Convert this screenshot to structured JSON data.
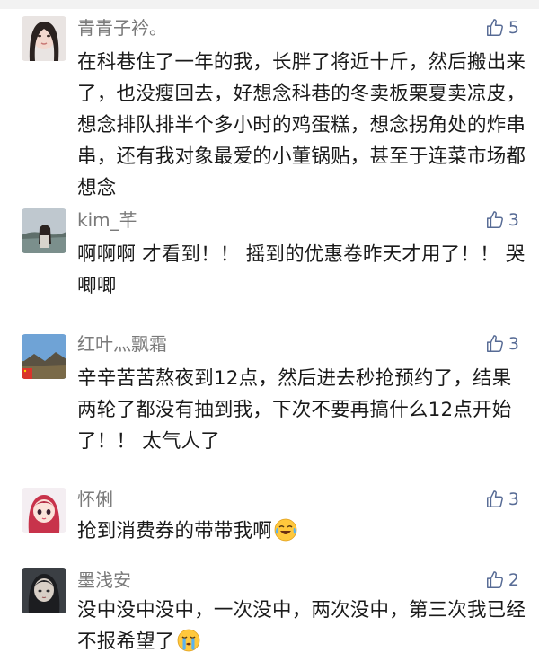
{
  "comments": [
    {
      "name": "青青子衿。",
      "likes": "5",
      "text": "在科巷住了一年的我，长胖了将近十斤，然后搬出来了，也没瘦回去，好想念科巷的冬卖板栗夏卖凉皮，想念排队排半个多小时的鸡蛋糕，想念拐角处的炸串串，还有我对象最爱的小董锅贴，甚至于连菜市场都想念"
    },
    {
      "name": "kim_芊",
      "likes": "3",
      "text": "啊啊啊 才看到！！ 摇到的优惠卷昨天才用了！！ 哭唧唧"
    },
    {
      "name": "红叶灬飘霜",
      "likes": "3",
      "text": "辛辛苦苦熬夜到12点，然后进去秒抢预约了，结果两轮了都没有抽到我，下次不要再搞什么12点开始了！！ 太气人了"
    },
    {
      "name": "怀俐",
      "likes": "3",
      "text": "抢到消费券的带带我啊",
      "emoji": "laugh-cry-emoji"
    },
    {
      "name": "墨浅安",
      "likes": "2",
      "text": "没中没中没中，一次没中，两次没中，第三次我已经不报希望了",
      "emoji": "crying-emoji"
    }
  ],
  "colors": {
    "name": "#7a7a7a",
    "like": "#576b95",
    "text": "#1a1a1a"
  }
}
